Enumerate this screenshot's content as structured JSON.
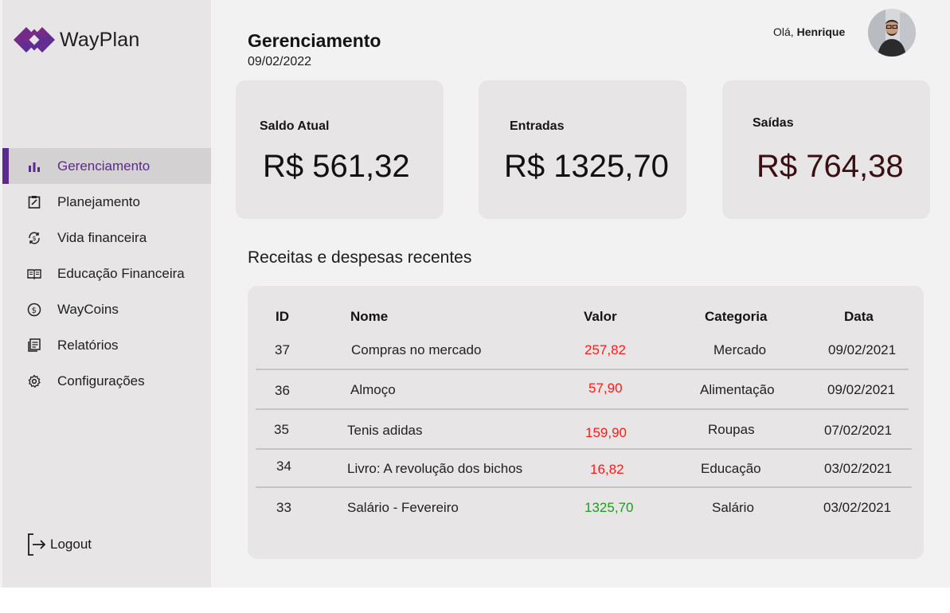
{
  "brand": {
    "name": "WayPlan",
    "accent": "#5b2a8c",
    "logo_gradient": [
      "#8a2a7a",
      "#4a2fa0"
    ]
  },
  "sidebar": {
    "items": [
      {
        "label": "Gerenciamento",
        "icon": "bar-chart-icon",
        "active": true
      },
      {
        "label": "Planejamento",
        "icon": "clipboard-icon"
      },
      {
        "label": "Vida financeira",
        "icon": "dollar-refresh-icon"
      },
      {
        "label": "Educação Financeira",
        "icon": "book-icon"
      },
      {
        "label": "WayCoins",
        "icon": "coin-icon"
      },
      {
        "label": "Relatórios",
        "icon": "report-icon"
      },
      {
        "label": "Configurações",
        "icon": "gear-icon"
      }
    ],
    "logout_label": "Logout"
  },
  "header": {
    "title": "Gerenciamento",
    "date": "09/02/2022",
    "greeting": "Olá,",
    "user_name": "Henrique"
  },
  "cards": [
    {
      "label": "Saldo Atual",
      "value": "R$ 561,32",
      "color": "#111111"
    },
    {
      "label": "Entradas",
      "value": "R$ 1325,70",
      "color": "#111111"
    },
    {
      "label": "Saídas",
      "value": "R$ 764,38",
      "color": "#3a0f14"
    }
  ],
  "transactions": {
    "title": "Receitas e despesas recentes",
    "columns": [
      "ID",
      "Nome",
      "Valor",
      "Categoria",
      "Data"
    ],
    "rows": [
      {
        "id": "37",
        "name": "Compras no mercado",
        "value": "257,82",
        "category": "Mercado",
        "date": "09/02/2021",
        "type": "expense"
      },
      {
        "id": "36",
        "name": "Almoço",
        "value": "57,90",
        "category": "Alimentação",
        "date": "09/02/2021",
        "type": "expense"
      },
      {
        "id": "35",
        "name": "Tenis adidas",
        "value": "159,90",
        "category": "Roupas",
        "date": "07/02/2021",
        "type": "expense"
      },
      {
        "id": "34",
        "name": "Livro: A revolução dos bichos",
        "value": "16,82",
        "category": "Educação",
        "date": "03/02/2021",
        "type": "expense"
      },
      {
        "id": "33",
        "name": "Salário - Fevereiro",
        "value": "1325,70",
        "category": "Salário",
        "date": "03/02/2021",
        "type": "income"
      }
    ],
    "colors": {
      "expense": "#ff1a1a",
      "income": "#1f9a1f"
    }
  }
}
